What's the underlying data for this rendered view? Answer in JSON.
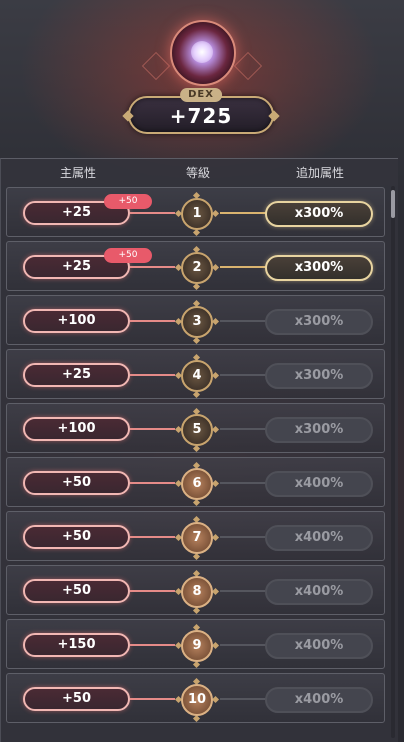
{
  "header": {
    "stat_label": "DEX",
    "stat_value": "+725"
  },
  "columns": {
    "main": "主属性",
    "level": "等級",
    "bonus": "追加属性"
  },
  "rows": [
    {
      "main": "+25",
      "plus": "+50",
      "level": "1",
      "bonus": "x300%",
      "active": true,
      "level_style": "dark"
    },
    {
      "main": "+25",
      "plus": "+50",
      "level": "2",
      "bonus": "x300%",
      "active": true,
      "level_style": "dark"
    },
    {
      "main": "+100",
      "plus": "",
      "level": "3",
      "bonus": "x300%",
      "active": false,
      "level_style": "dark"
    },
    {
      "main": "+25",
      "plus": "",
      "level": "4",
      "bonus": "x300%",
      "active": false,
      "level_style": "dark"
    },
    {
      "main": "+100",
      "plus": "",
      "level": "5",
      "bonus": "x300%",
      "active": false,
      "level_style": "dark"
    },
    {
      "main": "+50",
      "plus": "",
      "level": "6",
      "bonus": "x400%",
      "active": false,
      "level_style": "bronze"
    },
    {
      "main": "+50",
      "plus": "",
      "level": "7",
      "bonus": "x400%",
      "active": false,
      "level_style": "bronze"
    },
    {
      "main": "+50",
      "plus": "",
      "level": "8",
      "bonus": "x400%",
      "active": false,
      "level_style": "bronze"
    },
    {
      "main": "+150",
      "plus": "",
      "level": "9",
      "bonus": "x400%",
      "active": false,
      "level_style": "bronze"
    },
    {
      "main": "+50",
      "plus": "",
      "level": "10",
      "bonus": "x400%",
      "active": false,
      "level_style": "bronze"
    }
  ]
}
